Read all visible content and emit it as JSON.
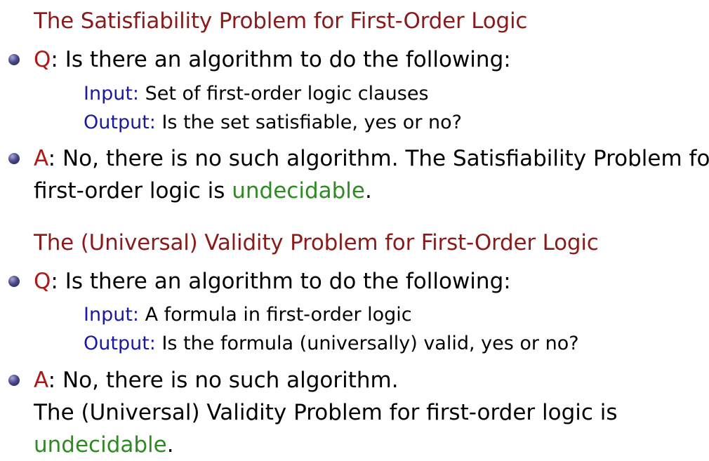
{
  "section1": {
    "heading": "The Satisfiability Problem for First-Order Logic",
    "q_label": "Q",
    "q_text": ": Is there an algorithm to do the following:",
    "input_label": "Input:",
    "input_text": " Set of first-order logic clauses",
    "output_label": "Output:",
    "output_text": " Is the set satisfiable, yes or no?",
    "a_label": "A",
    "a_line1": ": No, there is no such algorithm.  The Satisfiability Problem for",
    "a_line2_pre": "first-order logic is ",
    "a_undecidable": "undecidable",
    "a_period": "."
  },
  "section2": {
    "heading": "The (Universal) Validity Problem for First-Order Logic",
    "q_label": "Q",
    "q_text": ": Is there an algorithm to do the following:",
    "input_label": "Input:",
    "input_text": " A formula in first-order logic",
    "output_label": "Output:",
    "output_text": " Is the formula (universally) valid, yes or no?",
    "a_label": "A",
    "a_line1": ": No, there is no such algorithm.",
    "a_line2": "The (Universal) Validity Problem for first-order logic is",
    "a_undecidable": "undecidable",
    "a_period": "."
  },
  "colors": {
    "heading": "#8b1a1a",
    "label_red": "#b01818",
    "label_blue": "#1a1aa0",
    "highlight_green": "#2e8b22"
  }
}
